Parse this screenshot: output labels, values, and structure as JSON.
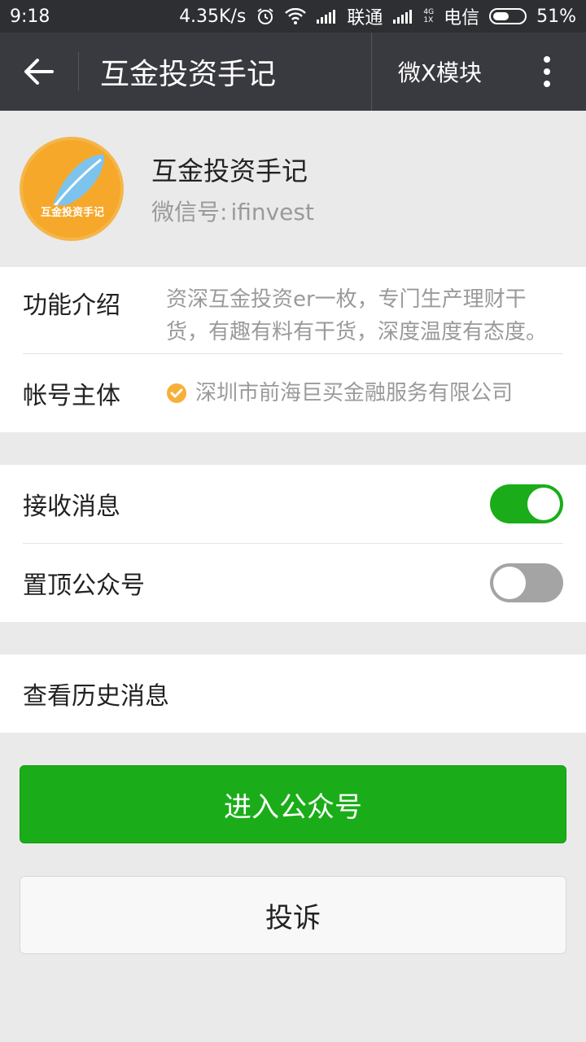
{
  "status_bar": {
    "time": "9:18",
    "net_speed": "4.35K/s",
    "carrier1": "联通",
    "net_type_top": "4G",
    "net_type_bottom": "1X",
    "carrier2": "电信",
    "battery": "51%",
    "battery_level": 0.51
  },
  "toolbar": {
    "title": "互金投资手记",
    "action_label": "微X模块"
  },
  "profile": {
    "name": "互金投资手记",
    "id_label": "微信号:",
    "id_value": "ifinvest",
    "avatar_text": "互金投资手记"
  },
  "info": {
    "intro_label": "功能介绍",
    "intro_value": "资深互金投资er一枚，专门生产理财干货，有趣有料有干货，深度温度有态度。",
    "subject_label": "帐号主体",
    "subject_value": "深圳市前海巨买金融服务有限公司"
  },
  "settings": {
    "receive_label": "接收消息",
    "receive_on": true,
    "pin_label": "置顶公众号",
    "pin_on": false
  },
  "history": {
    "label": "查看历史消息"
  },
  "buttons": {
    "enter": "进入公众号",
    "complain": "投诉"
  },
  "colors": {
    "accent_green": "#1aad19",
    "toolbar_bg": "#393a3f",
    "statusbar_bg": "#2d2f32",
    "avatar_orange": "#f6a82a"
  }
}
